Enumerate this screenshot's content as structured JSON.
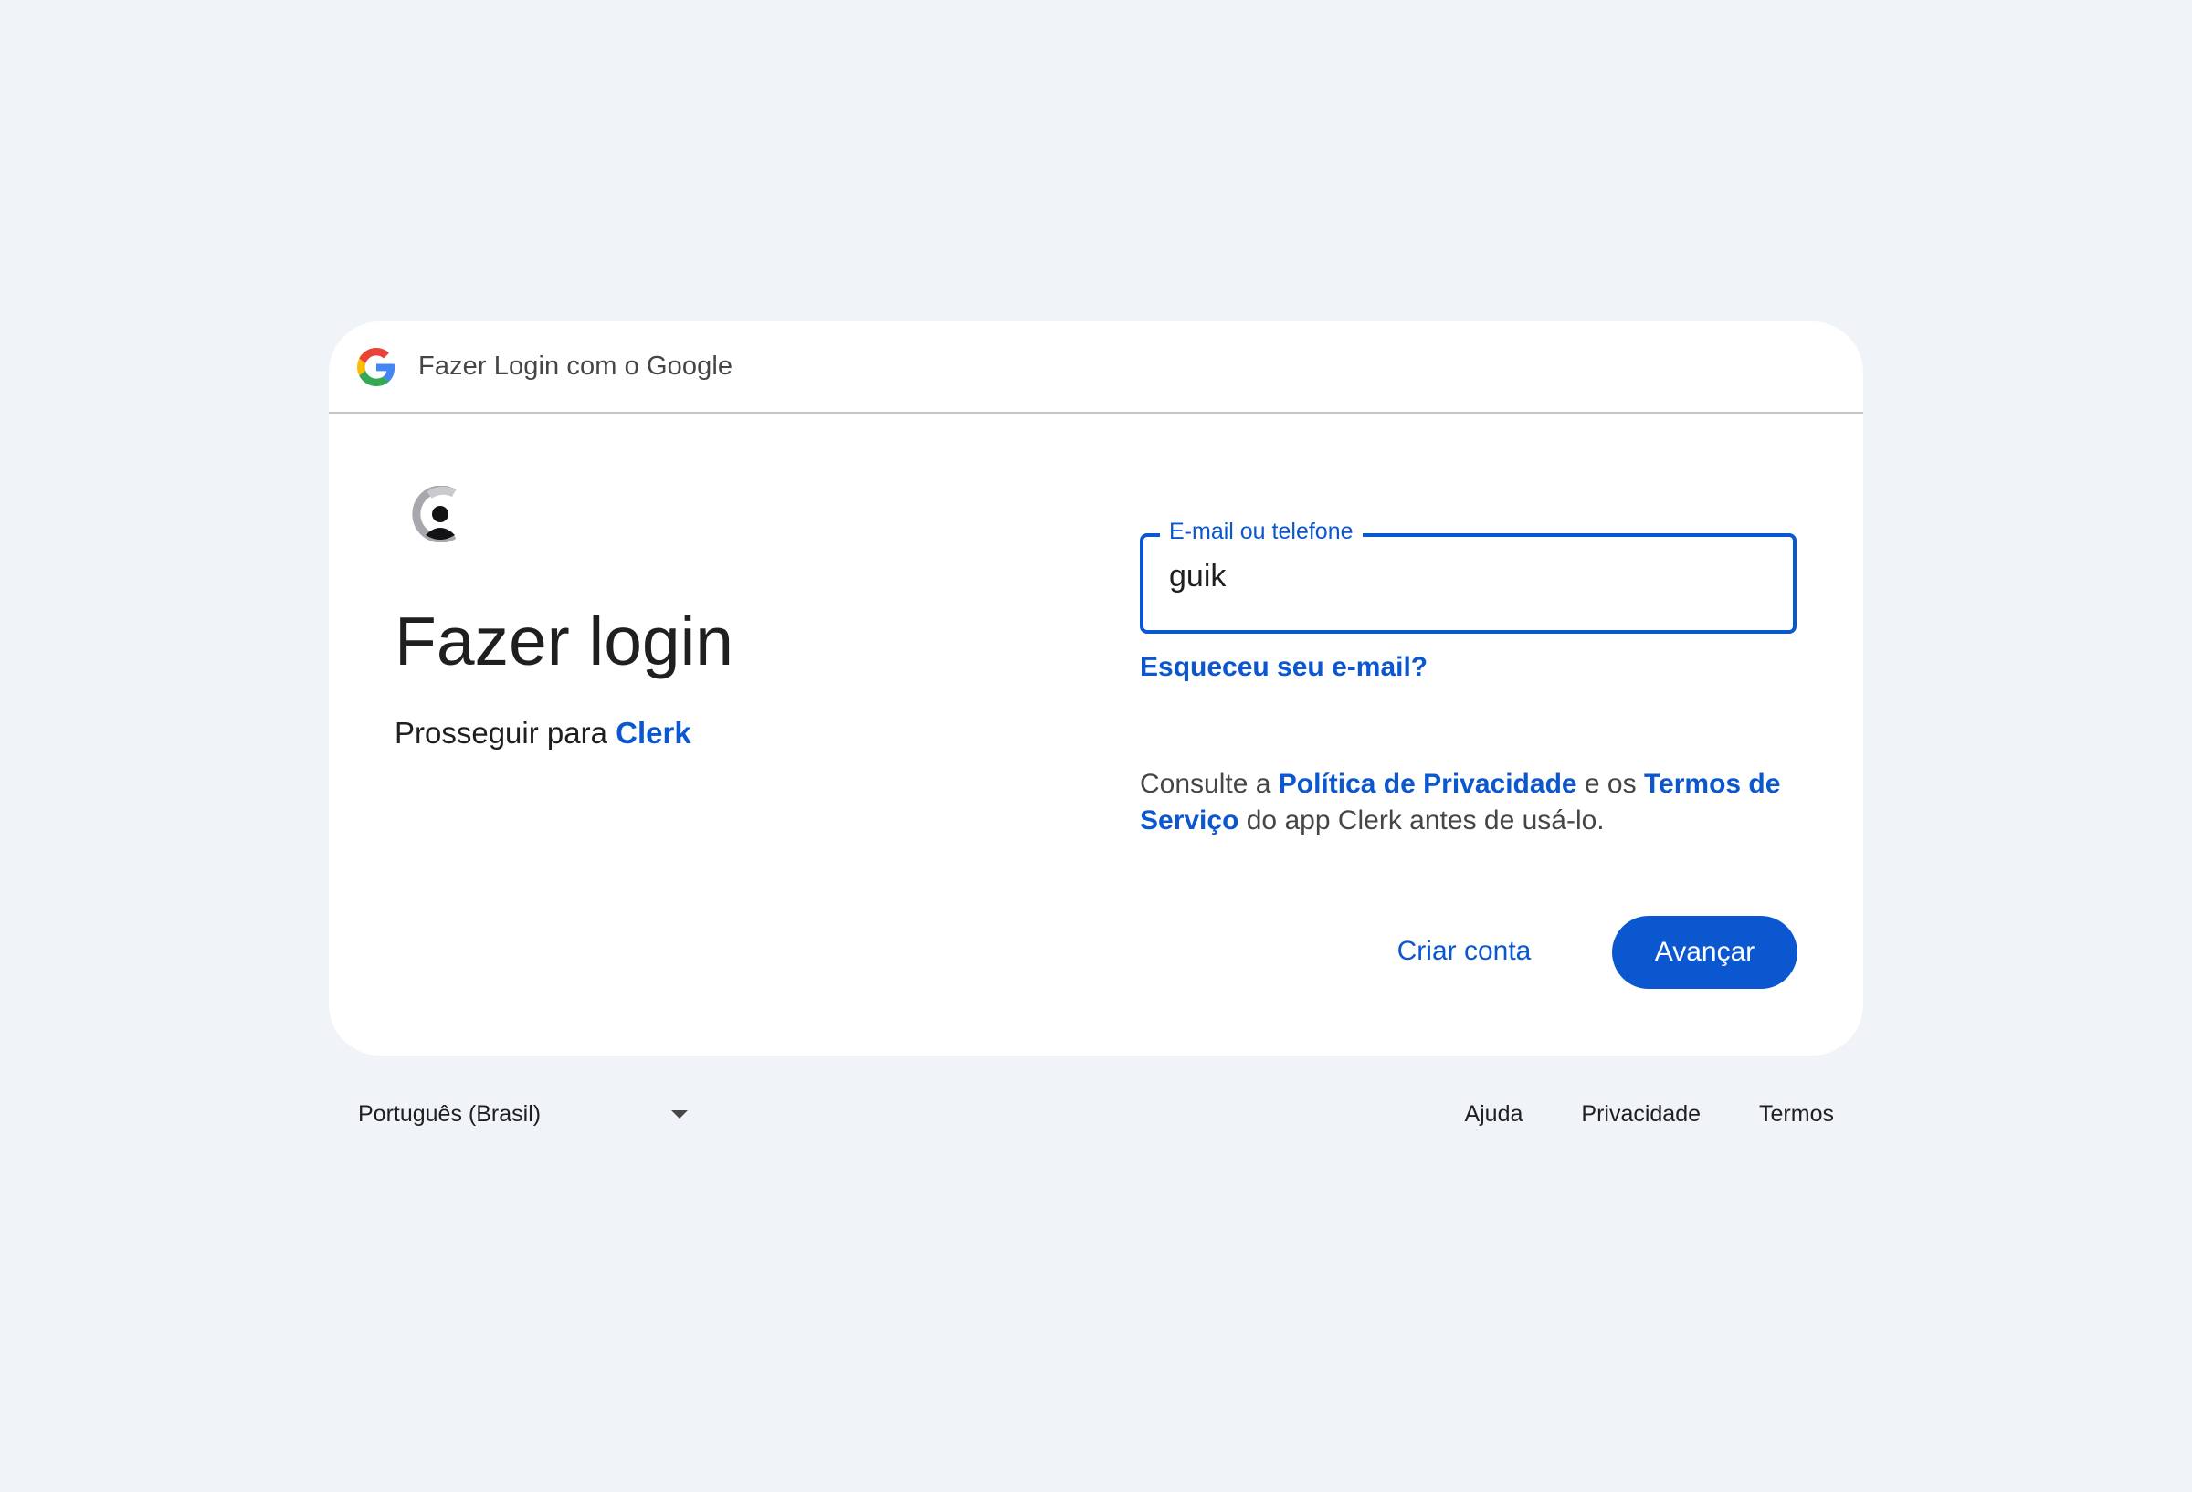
{
  "header": {
    "title": "Fazer Login com o Google",
    "logo_icon": "google-g-icon"
  },
  "app": {
    "logo_icon": "clerk-logo-icon",
    "name": "Clerk"
  },
  "main": {
    "title": "Fazer login",
    "subtitle_prefix": "Prosseguir para ",
    "subtitle_link": "Clerk"
  },
  "form": {
    "email_label": "E-mail ou telefone",
    "email_value": "guik",
    "forgot_link": "Esqueceu seu e-mail?"
  },
  "consent": {
    "text_1": "Consulte a ",
    "privacy_link": "Política de Privacidade",
    "text_2": " e os ",
    "terms_link": "Termos de Serviço",
    "text_3": " do app Clerk antes de usá-lo."
  },
  "actions": {
    "create_account": "Criar conta",
    "next": "Avançar"
  },
  "footer": {
    "language": "Português (Brasil)",
    "links": {
      "help": "Ajuda",
      "privacy": "Privacidade",
      "terms": "Termos"
    }
  },
  "colors": {
    "accent": "#0b57d0",
    "background": "#f0f3f8",
    "card": "#ffffff",
    "text": "#1f1f1f"
  }
}
